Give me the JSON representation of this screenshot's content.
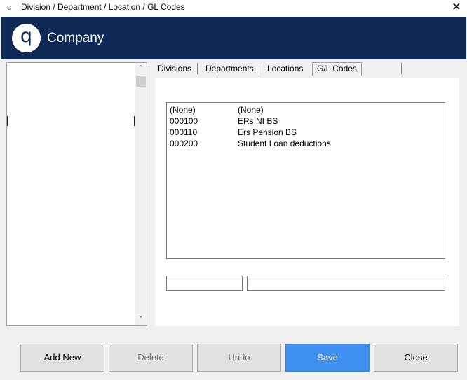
{
  "window": {
    "title": "Division / Department / Location / GL Codes",
    "app_icon": "q",
    "close_glyph": "✕"
  },
  "banner": {
    "logo_letter": "q",
    "company": "Company"
  },
  "tree": {
    "scroll_up": "˄",
    "scroll_down": "˅"
  },
  "tabs": [
    {
      "label": "Divisions",
      "active": false
    },
    {
      "label": "Departments",
      "active": false
    },
    {
      "label": "Locations",
      "active": false
    },
    {
      "label": "G/L Codes",
      "active": true
    }
  ],
  "gl_list": [
    {
      "code": "(None)",
      "description": "(None)"
    },
    {
      "code": "000100",
      "description": "ERs NI BS"
    },
    {
      "code": "000110",
      "description": "Ers Pension BS"
    },
    {
      "code": "000200",
      "description": "Student Loan deductions"
    }
  ],
  "fields": {
    "code_value": "",
    "description_value": ""
  },
  "buttons": {
    "add_new": "Add New",
    "delete": "Delete",
    "undo": "Undo",
    "save": "Save",
    "close": "Close"
  },
  "colors": {
    "banner": "#0f2a55",
    "save_accent": "#3e8ef0"
  }
}
